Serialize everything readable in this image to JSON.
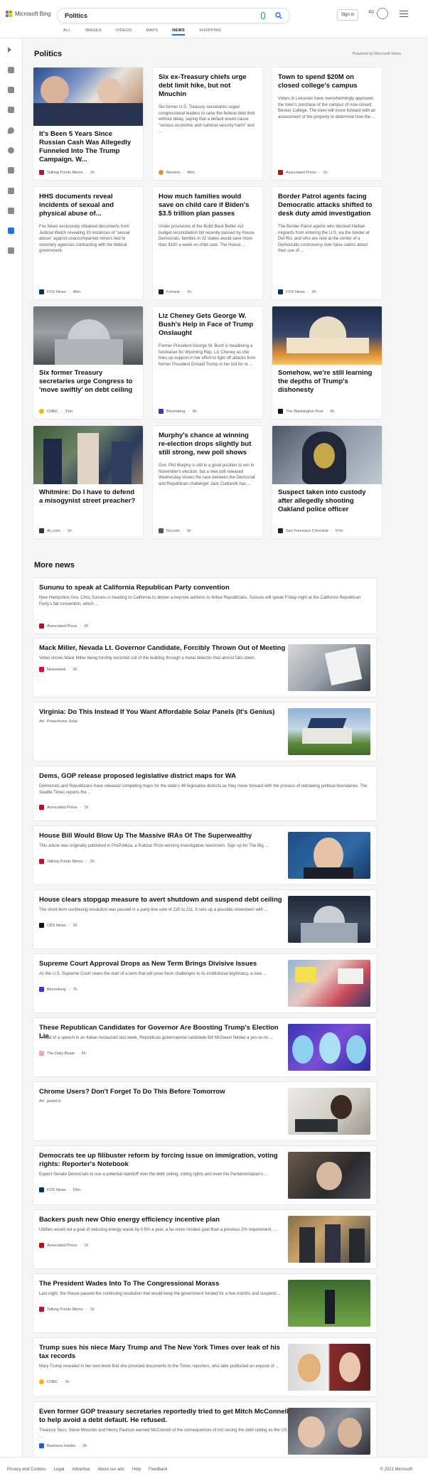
{
  "header": {
    "brand": "Microsoft Bing",
    "query": "Politics",
    "signin": "Sign in",
    "rewards_count": "40",
    "tabs": [
      "ALL",
      "IMAGES",
      "VIDEOS",
      "MAPS",
      "NEWS",
      "SHOPPING"
    ],
    "active_tab": "NEWS",
    "colors": {
      "accent": "#1a73e8"
    }
  },
  "politics": {
    "title": "Politics",
    "powered_by": "Powered by Microsoft News",
    "cards": [
      {
        "title": "It's Been 5 Years Since Russian Cash Was Allegedly Funneled Into The Trump Campaign. W...",
        "desc": "",
        "source": "Talking Points Memo",
        "age": "1h",
        "logo_color": "#c8102e",
        "has_image": true
      },
      {
        "title": "Six ex-Treasury chiefs urge debt limit hike, but not Mnuchin",
        "desc": "Six former U.S. Treasury secretaries urged congressional leaders to raise the federal debt limit without delay, saying that a default would cause \"serious economic and national security harm\" and ...",
        "source": "Reuters",
        "age": "46m",
        "logo_color": "#f28c28",
        "has_image": false
      },
      {
        "title": "Town to spend $20M on closed college's campus",
        "desc": "Voters in Leicester have overwhelmingly approved the town's purchase of the campus of now-closed Becker College. The town will move forward with an assessment of the property to determine how the ...",
        "source": "Associated Press",
        "age": "1h",
        "logo_color": "#d0021b",
        "has_image": false
      },
      {
        "title": "HHS documents reveal incidents of sexual and physical abuse of...",
        "desc": "Fox News exclusively obtained documents from Judicial Watch revealing 33 instances of \"sexual abuse\" against unaccompanied minors tied to voluntary agencies contracting with the federal government.",
        "source": "FOX News",
        "age": "46m",
        "logo_color": "#003366",
        "has_image": false
      },
      {
        "title": "How much families would save on child care if Biden's $3.5 trillion plan passes",
        "desc": "Under provisions of the Build Back Better Act budget reconciliation bill recently passed by House Democrats, families in 32 states would save more than $100 a week on child care. The House ...",
        "source": "Fortune",
        "age": "1h",
        "logo_color": "#222222",
        "has_image": false
      },
      {
        "title": "Border Patrol agents facing Democratic attacks shifted to desk duty amid investigation",
        "desc": "The Border Patrol agents who blocked Haitian migrants from entering the U.S. via the border at Del Rio, and who are now at the center of a Democratic controversy over false claims about their use of ...",
        "source": "FOX News",
        "age": "2h",
        "logo_color": "#003366",
        "has_image": false
      },
      {
        "title": "Six former Treasury secretaries urge Congress to 'move swiftly' on debt ceiling",
        "desc": "",
        "source": "CNBC",
        "age": "31m",
        "logo_color": "#f4b400",
        "has_image": true
      },
      {
        "title": "Liz Cheney Gets George W. Bush's Help in Face of Trump Onslaught",
        "desc": "Former President George W. Bush is headlining a fundraiser for Wyoming Rep. Liz Cheney as she lines up support in her effort to fight off attacks from former President Donald Trump in her bid for re ...",
        "source": "Bloomberg",
        "age": "3h",
        "logo_color": "#4b2bd6",
        "has_image": false
      },
      {
        "title": "Somehow, we're still learning the depths of Trump's dishonesty",
        "desc": "",
        "source": "The Washington Post",
        "age": "2h",
        "logo_color": "#111111",
        "has_image": true
      },
      {
        "title": "Whitmire: Do I have to defend a misogynist street preacher?",
        "desc": "",
        "source": "AL.com",
        "age": "1h",
        "logo_color": "#333333",
        "has_image": true
      },
      {
        "title": "Murphy's chance at winning re-election drops slightly but still strong, new poll shows",
        "desc": "Gov. Phil Murphy is still in a good position to win in November's election, but a new poll released Wednesday shows the race between the Democrat and Republican challenger Jack Ciattarelli has ...",
        "source": "NJ.com",
        "age": "1h",
        "logo_color": "#555555",
        "has_image": false
      },
      {
        "title": "Suspect taken into custody after allegedly shooting Oakland police officer",
        "desc": "",
        "source": "San Francisco Chronicle",
        "age": "57m",
        "logo_color": "#222222",
        "has_image": true
      }
    ]
  },
  "more_news": {
    "title": "More news",
    "items": [
      {
        "title": "Sununu to speak at California Republican Party convention",
        "desc": "New Hampshire Gov. Chris Sununu is heading to California to deliver a keynote address to fellow Republicans. Sununu will speak Friday night at the California Republican Party's fall convention, which ...",
        "source": "Associated Press",
        "age": "2h",
        "logo_color": "#d0021b",
        "thumb": false
      },
      {
        "title": "Mack Miller, Nevada Lt. Governor Candidate, Forcibly Thrown Out of Meeting",
        "desc": "Video shows Mack Miller being forcibly escorted out of the building through a metal detector that almost falls down.",
        "source": "Newsweek",
        "age": "2h",
        "logo_color": "#e4002b",
        "thumb": true
      },
      {
        "title": "Virginia: Do This Instead If You Want Affordable Solar Panels (It's Genius)",
        "desc": "",
        "source": "Powerhome Solar",
        "age": "",
        "ad": "Ad",
        "logo_color": "",
        "thumb": true
      },
      {
        "title": "Dems, GOP release proposed legislative district maps for WA",
        "desc": "Democrats and Republicans have released competing maps for the state's 49 legislative districts as they move forward with the process of redrawing political boundaries. The Seattle Times reports the ...",
        "source": "Associated Press",
        "age": "1h",
        "logo_color": "#d0021b",
        "thumb": false
      },
      {
        "title": "House Bill Would Blow Up The Massive IRAs Of The Superwealthy",
        "desc": "This article was originally published in ProPublica, a Pulitzer Prize-winning investigative newsroom. Sign up for The Big ...",
        "source": "Talking Points Memo",
        "age": "2h",
        "logo_color": "#c8102e",
        "thumb": true
      },
      {
        "title": "House clears stopgap measure to avert shutdown and suspend debt ceiling",
        "desc": "The short-term continuing resolution was passed in a party-line vote of 220 to 211. It sets up a possible showdown with ...",
        "source": "CBS News",
        "age": "2h",
        "logo_color": "#111111",
        "thumb": true
      },
      {
        "title": "Supreme Court Approval Drops as New Term Brings Divisive Issues",
        "desc": "As the U.S. Supreme Court nears the start of a term that will pose fresh challenges to its institutional legitimacy, a new ...",
        "source": "Bloomberg",
        "age": "7h",
        "logo_color": "#4b2bd6",
        "thumb": true
      },
      {
        "title": "These Republican Candidates for Governor Are Boosting Trump's Election Lie",
        "desc": "Ahead of a speech in an Italian restaurant last week, Republican gubernatorial candidate Bill McSwain fielded a yes-or-no ...",
        "source": "The Daily Beast",
        "age": "4h",
        "logo_color": "#f2a7b0",
        "thumb": true
      },
      {
        "title": "Chrome Users? Don't Forget To Do This Before Tomorrow",
        "desc": "",
        "source": "guard.io",
        "age": "",
        "ad": "Ad",
        "logo_color": "",
        "thumb": true
      },
      {
        "title": "Democrats tee up filibuster reform by forcing issue on immigration, voting rights: Reporter's Notebook",
        "desc": "Expect Senate Democrats to use a potential standoff over the debt ceiling, voting rights and even the Parliamentarian's ...",
        "source": "FOX News",
        "age": "53m",
        "logo_color": "#003366",
        "thumb": true
      },
      {
        "title": "Backers push new Ohio energy efficiency incentive plan",
        "desc": "Utilities would set a goal of reducing energy waste by 0.5% a year, a far-more modest goal than a previous 2% requirement, ...",
        "source": "Associated Press",
        "age": "1h",
        "logo_color": "#d0021b",
        "thumb": true
      },
      {
        "title": "The President Wades Into To The Congressional Morass",
        "desc": "Last night, the House passed the continuing resolution that would keep the government funded for a few months and suspend ...",
        "source": "Talking Points Memo",
        "age": "1h",
        "logo_color": "#c8102e",
        "thumb": true
      },
      {
        "title": "Trump sues his niece Mary Trump and The New York Times over leak of his tax records",
        "desc": "Mary Trump revealed in her own book that she provided documents to the Times reporters, who later published an exposé of ...",
        "source": "CNBC",
        "age": "1h",
        "logo_color": "#f4b400",
        "thumb": true
      },
      {
        "title": "Even former GOP treasury secretaries reportedly tried to get Mitch McConnell to help avoid a debt default. He refused.",
        "desc": "Treasury Secs. Steve Mnuchin and Henry Paulson warned McConnell of the consequences of not raising the debt ceiling as the US ...",
        "source": "Business Insider",
        "age": "2h",
        "logo_color": "#1e5fd6",
        "thumb": true
      }
    ]
  },
  "footer": {
    "links": [
      "Privacy and Cookies",
      "Legal",
      "Advertise",
      "About our ads",
      "Help",
      "Feedback"
    ],
    "copyright": "© 2021 Microsoft"
  }
}
